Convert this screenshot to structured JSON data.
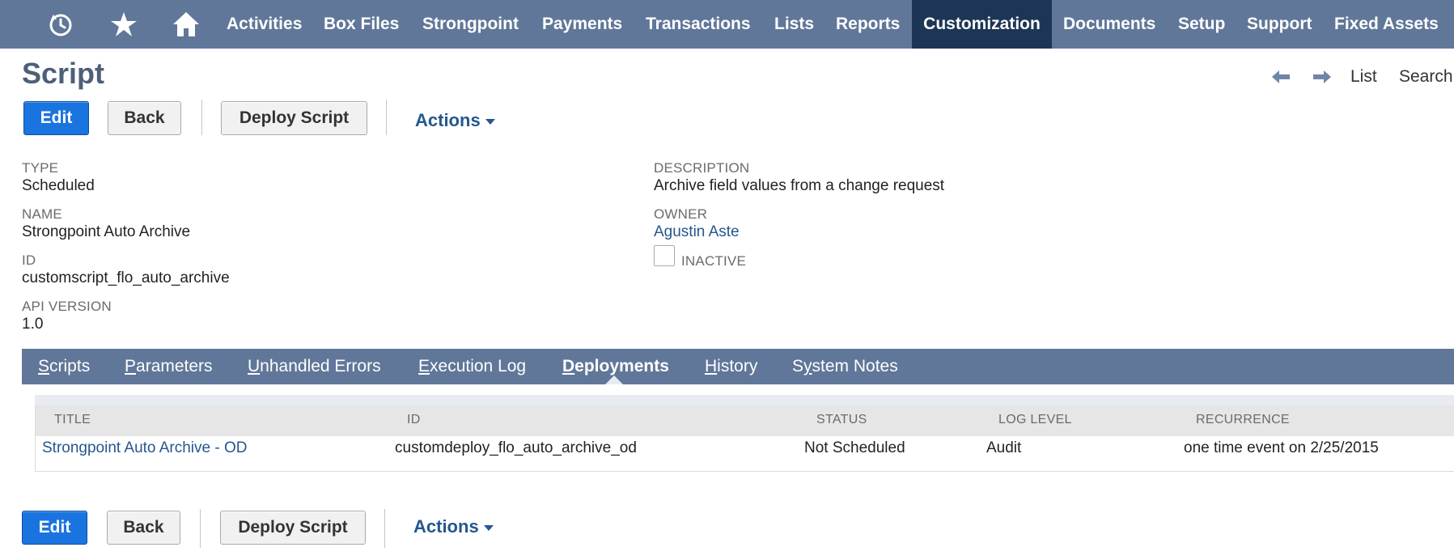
{
  "nav": {
    "items": [
      {
        "label": "Activities"
      },
      {
        "label": "Box Files"
      },
      {
        "label": "Strongpoint"
      },
      {
        "label": "Payments"
      },
      {
        "label": "Transactions"
      },
      {
        "label": "Lists"
      },
      {
        "label": "Reports"
      },
      {
        "label": "Customization",
        "active": true
      },
      {
        "label": "Documents"
      },
      {
        "label": "Setup"
      },
      {
        "label": "Support"
      },
      {
        "label": "Fixed Assets"
      }
    ],
    "icons": [
      "recent-history-icon",
      "star-icon",
      "home-icon"
    ]
  },
  "page": {
    "title": "Script",
    "pager": {
      "list_label": "List",
      "search_label": "Search"
    }
  },
  "toolbar": {
    "edit_label": "Edit",
    "back_label": "Back",
    "deploy_label": "Deploy Script",
    "actions_label": "Actions"
  },
  "fields": {
    "type": {
      "label": "TYPE",
      "value": "Scheduled"
    },
    "name": {
      "label": "NAME",
      "value": "Strongpoint Auto Archive"
    },
    "id": {
      "label": "ID",
      "value": "customscript_flo_auto_archive"
    },
    "api_version": {
      "label": "API VERSION",
      "value": "1.0"
    },
    "description": {
      "label": "DESCRIPTION",
      "value": "Archive field values from a change request"
    },
    "owner": {
      "label": "OWNER",
      "value": "Agustin Aste"
    },
    "inactive": {
      "label": "INACTIVE",
      "checked": false
    }
  },
  "subtabs": [
    {
      "label": "Scripts"
    },
    {
      "label": "Parameters"
    },
    {
      "label": "Unhandled Errors"
    },
    {
      "label": "Execution Log"
    },
    {
      "label": "Deployments",
      "active": true
    },
    {
      "label": "History"
    },
    {
      "label": "System Notes"
    }
  ],
  "deployments": {
    "columns": [
      "TITLE",
      "ID",
      "STATUS",
      "LOG LEVEL",
      "RECURRENCE"
    ],
    "rows": [
      {
        "title": "Strongpoint Auto Archive - OD",
        "id": "customdeploy_flo_auto_archive_od",
        "status": "Not Scheduled",
        "log_level": "Audit",
        "recurrence": "one time event on 2/25/2015"
      }
    ]
  },
  "colors": {
    "nav_bg": "#607799",
    "nav_active": "#1d3656",
    "primary_button": "#1a74e0",
    "link": "#24578f",
    "title": "#4d5f79"
  }
}
